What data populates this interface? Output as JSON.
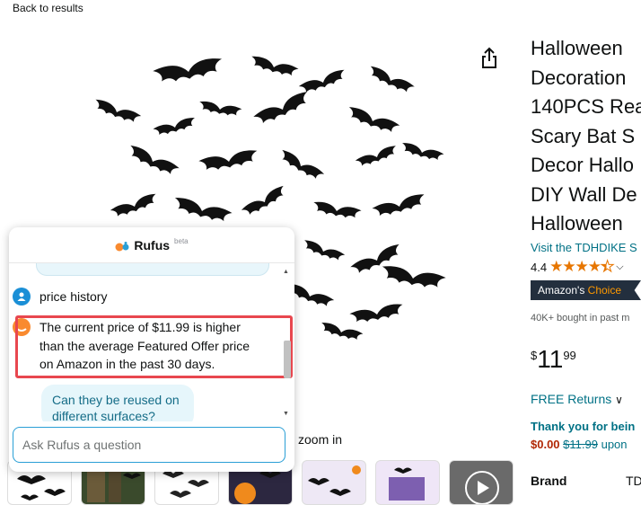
{
  "nav": {
    "back_label": "Back to results"
  },
  "image": {
    "zoom_hint": "zoom in"
  },
  "product": {
    "title_lines": [
      "Halloween",
      "Decoration",
      "140PCS Rea",
      "Scary Bat S",
      "Decor Hallo",
      "DIY Wall De",
      "Halloween"
    ],
    "store_link": "Visit the TDHDIKE S",
    "rating_value": "4.4",
    "rating_stars": 4.4,
    "choice_prefix": "Amazon's",
    "choice_word": "Choice",
    "bought_text": "40K+ bought in past m",
    "price": {
      "symbol": "$",
      "whole": "11",
      "fraction": "99"
    },
    "free_returns": "FREE Returns",
    "thank_you": "Thank you for bein",
    "promo": {
      "new_price": "$0.00",
      "old_price": "$11.99",
      "rest": "upon"
    },
    "brand_label": "Brand",
    "brand_value": "TD"
  },
  "rufus": {
    "name": "Rufus",
    "badge": "beta",
    "user_message": "price history",
    "bot_lines": [
      "The current price of $11.99 is higher",
      "than the average Featured Offer price",
      "on Amazon in the past 30 days."
    ],
    "suggestion": "Can they be reused on different surfaces?",
    "input_placeholder": "Ask Rufus a question"
  },
  "colors": {
    "link": "#007185",
    "price_red": "#b12704",
    "star": "#e77600",
    "highlight": "#e8474f",
    "rufus_accent": "#2a9fd6"
  }
}
